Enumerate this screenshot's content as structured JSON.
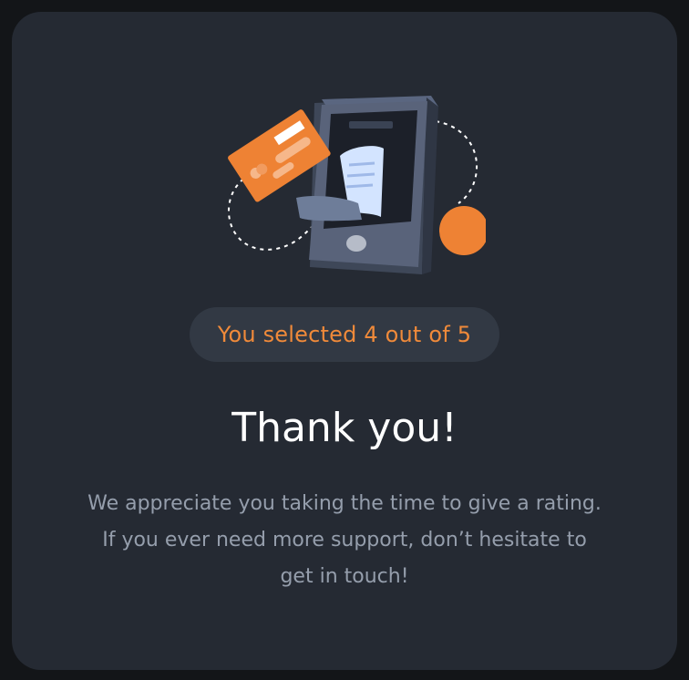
{
  "rating": {
    "selected": 4,
    "max": 5,
    "badge_text": "You selected 4 out of 5"
  },
  "thank_you": {
    "title": "Thank you!",
    "lines": [
      "We appreciate you taking the time to give a rating.",
      "If you ever need more support, don’t hesitate to",
      "get in touch!"
    ]
  },
  "illustration": {
    "icon": "payment-phone-illustration"
  },
  "colors": {
    "background": "#131518",
    "card": "#252a33",
    "accent": "#f08a3a",
    "badge_bg": "#323944",
    "title": "#ffffff",
    "body": "#959eac"
  }
}
